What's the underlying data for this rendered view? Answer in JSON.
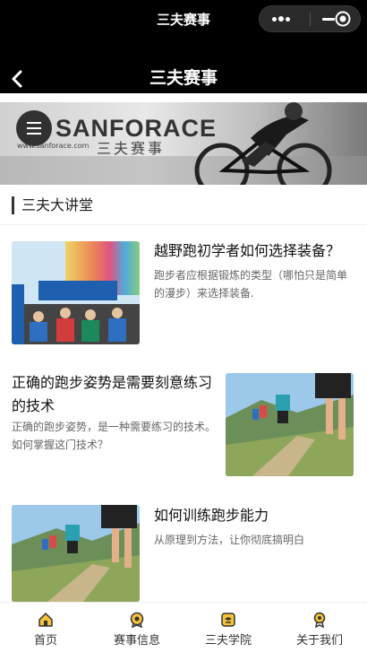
{
  "app": {
    "window_title": "三夫赛事"
  },
  "header": {
    "title": "三夫赛事"
  },
  "banner": {
    "logo_text": "SANFORACE",
    "logo_cn": "三夫赛事",
    "logo_url": "www.sanforace.com"
  },
  "section": {
    "title": "三夫大讲堂"
  },
  "articles": [
    {
      "title": "越野跑初学者如何选择装备？",
      "desc": "跑步者应根据锻炼的类型（哪怕只是简单的漫步）来选择装备."
    },
    {
      "title": "正确的跑步姿势是需要刻意练习的技术",
      "desc": "正确的跑步姿势，是一种需要练习的技术。如何掌握这门技术？"
    },
    {
      "title": "如何训练跑步能力",
      "desc": "从原理到方法，让你彻底搞明白"
    }
  ],
  "tabbar": {
    "items": [
      {
        "label": "首页",
        "icon": "home-icon"
      },
      {
        "label": "赛事信息",
        "icon": "medal-icon"
      },
      {
        "label": "三夫学院",
        "icon": "academy-icon"
      },
      {
        "label": "关于我们",
        "icon": "about-icon"
      }
    ]
  }
}
